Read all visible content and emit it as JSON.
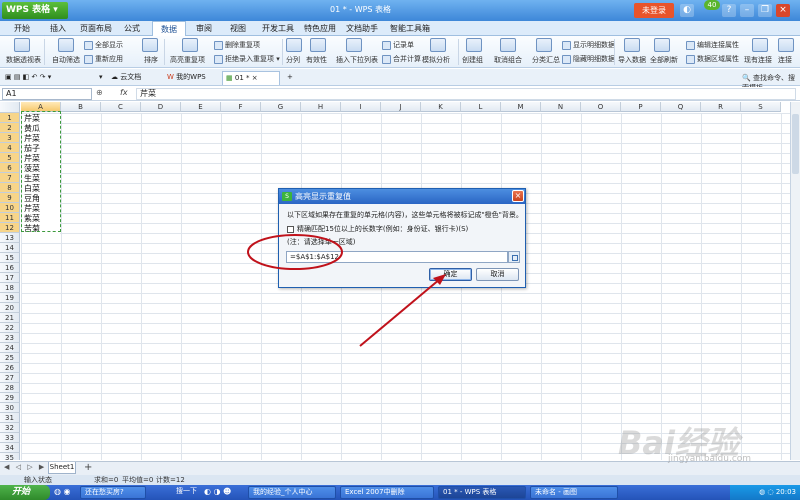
{
  "titlebar": {
    "app_name": "WPS 表格",
    "title": "01 * - WPS 表格",
    "login": "未登录",
    "badge": "40"
  },
  "menu": {
    "tabs": [
      "开始",
      "插入",
      "页面布局",
      "公式",
      "数据",
      "审阅",
      "视图",
      "开发工具",
      "特色应用",
      "文档助手",
      "智能工具箱"
    ]
  },
  "ribbon": {
    "data_view": "数据透视表",
    "show_all": "全部显示",
    "auto_filter": "自动筛选",
    "reapply": "重新应用",
    "sort": "排序",
    "highlight_dup": "高亮重复项",
    "delete_dup": "删除重复项",
    "reject_dup": "拒绝录入重复项",
    "split": "分列",
    "validity": "有效性",
    "insert_dropdown": "插入下拉列表",
    "record": "记录单",
    "merge_calc": "合并计算",
    "simulate": "模拟分析",
    "create_group": "创建组",
    "cancel_group": "取消组合",
    "subtotal": "分类汇总",
    "show_detail": "显示明细数据",
    "hide_detail": "隐藏明细数据",
    "import_data": "导入数据",
    "refresh_all": "全部刷新",
    "edit_link": "编辑连接属性",
    "data_region": "数据区域属性",
    "existing_conn": "现有连接",
    "connect": "连接"
  },
  "doctabs": {
    "cloud": "云文档",
    "mywps": "我的WPS",
    "current": "01 *",
    "help_search": "查找命令、搜索模板"
  },
  "formula": {
    "namebox": "A1",
    "fx": "fx",
    "content": "芹菜"
  },
  "grid": {
    "columns": [
      "A",
      "B",
      "C",
      "D",
      "E",
      "F",
      "G",
      "H",
      "I",
      "J",
      "K",
      "L",
      "M",
      "N",
      "O",
      "P",
      "Q",
      "R",
      "S"
    ],
    "rows": [
      "1",
      "2",
      "3",
      "4",
      "5",
      "6",
      "7",
      "8",
      "9",
      "10",
      "11",
      "12",
      "13",
      "14",
      "15",
      "16",
      "17",
      "18",
      "19",
      "20",
      "21",
      "22",
      "23",
      "24",
      "25",
      "26",
      "27",
      "28",
      "29",
      "30",
      "31",
      "32",
      "33",
      "34",
      "35"
    ],
    "column_a": [
      "芹菜",
      "黄瓜",
      "芹菜",
      "茄子",
      "芹菜",
      "菠菜",
      "生菜",
      "白菜",
      "豆角",
      "芹菜",
      "紫菜",
      "苦菊"
    ]
  },
  "dialog": {
    "title": "高亮显示重复值",
    "title_icon": "S",
    "close": "×",
    "description": "以下区域如果存在重复的单元格(内容)，这些单元格将被标记成\"橙色\"背景。",
    "checkbox_label": "精确匹配15位以上的长数字(例如：身份证、银行卡)(S)",
    "note": "(注：请选择单一区域)",
    "range_value": "=$A$1:$A$12",
    "ok": "确定",
    "cancel": "取消"
  },
  "sheets": {
    "nav": "◀ ◁ ▷ ▶",
    "active": "Sheet1",
    "add": "+"
  },
  "statusbar": {
    "mode": "输入状态",
    "sum": "求和=0",
    "average": "平均值=0",
    "count": "计数=12"
  },
  "taskbar": {
    "start": "开始",
    "items": [
      "还在愁买房?",
      "搜一下",
      "我的经验_个人中心",
      "Excel 2007中删除",
      "01 * - WPS 表格",
      "未命名 - 画图"
    ],
    "clock": "20:03"
  },
  "watermark": {
    "text": "Bai经验",
    "sub": "jingyan.baidu.com"
  },
  "colors": {
    "accent": "#3d87d8",
    "selection": "#3c9a3c",
    "annotation": "#c0121b"
  }
}
